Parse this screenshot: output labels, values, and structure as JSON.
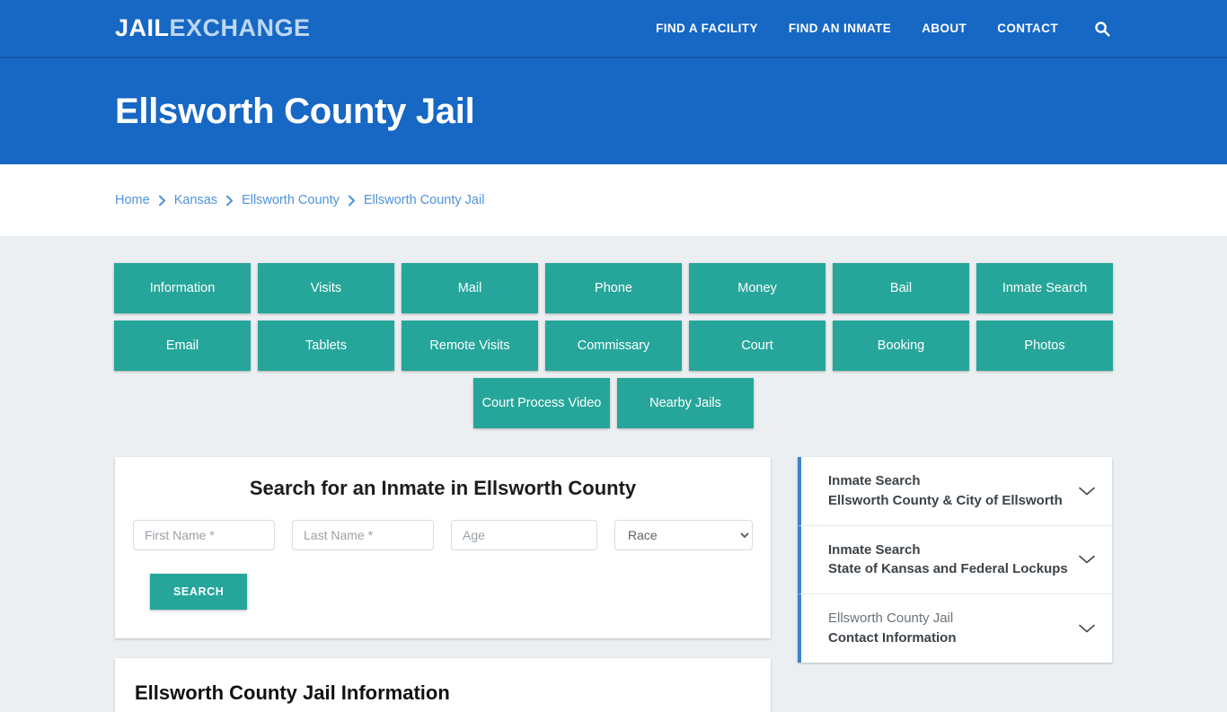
{
  "brand": {
    "part1": "JAIL",
    "part2": "EXCHANGE"
  },
  "colors": {
    "header_blue": "#1767c4",
    "teal": "#26a69a",
    "link_blue": "#4f93dd",
    "accent_blue": "#3b85d0",
    "page_bg": "#eceff1"
  },
  "nav": {
    "items": [
      {
        "label": "FIND A FACILITY"
      },
      {
        "label": "FIND AN INMATE"
      },
      {
        "label": "ABOUT"
      },
      {
        "label": "CONTACT"
      }
    ],
    "search_icon": "search-icon"
  },
  "header": {
    "title": "Ellsworth County Jail"
  },
  "breadcrumb": {
    "items": [
      {
        "label": "Home"
      },
      {
        "label": "Kansas"
      },
      {
        "label": "Ellsworth County"
      },
      {
        "label": "Ellsworth County Jail"
      }
    ],
    "separator_icon": "chevron-right-icon"
  },
  "tiles": {
    "row1": [
      {
        "label": "Information"
      },
      {
        "label": "Visits"
      },
      {
        "label": "Mail"
      },
      {
        "label": "Phone"
      },
      {
        "label": "Money"
      },
      {
        "label": "Bail"
      },
      {
        "label": "Inmate Search"
      }
    ],
    "row2": [
      {
        "label": "Email"
      },
      {
        "label": "Tablets"
      },
      {
        "label": "Remote Visits"
      },
      {
        "label": "Commissary"
      },
      {
        "label": "Court"
      },
      {
        "label": "Booking"
      },
      {
        "label": "Photos"
      }
    ],
    "row3": [
      {
        "label": "Court Process Video"
      },
      {
        "label": "Nearby Jails"
      }
    ]
  },
  "search_form": {
    "heading": "Search for an Inmate in Ellsworth County",
    "first_name_placeholder": "First Name *",
    "first_name_value": "",
    "last_name_placeholder": "Last Name *",
    "last_name_value": "",
    "age_placeholder": "Age",
    "age_value": "",
    "race_selected": "Race",
    "race_options": [
      "Race"
    ],
    "submit_label": "SEARCH"
  },
  "info_card": {
    "heading": "Ellsworth County Jail Information"
  },
  "sidebar": {
    "items": [
      {
        "line1": "Inmate Search",
        "line2": "Ellsworth County & City of Ellsworth",
        "chevron_icon": "chevron-down-icon"
      },
      {
        "line1": "Inmate Search",
        "line2": "State of Kansas and Federal Lockups",
        "chevron_icon": "chevron-down-icon"
      },
      {
        "line1": "Ellsworth County Jail",
        "line2": "Contact Information",
        "chevron_icon": "chevron-down-icon"
      }
    ]
  }
}
